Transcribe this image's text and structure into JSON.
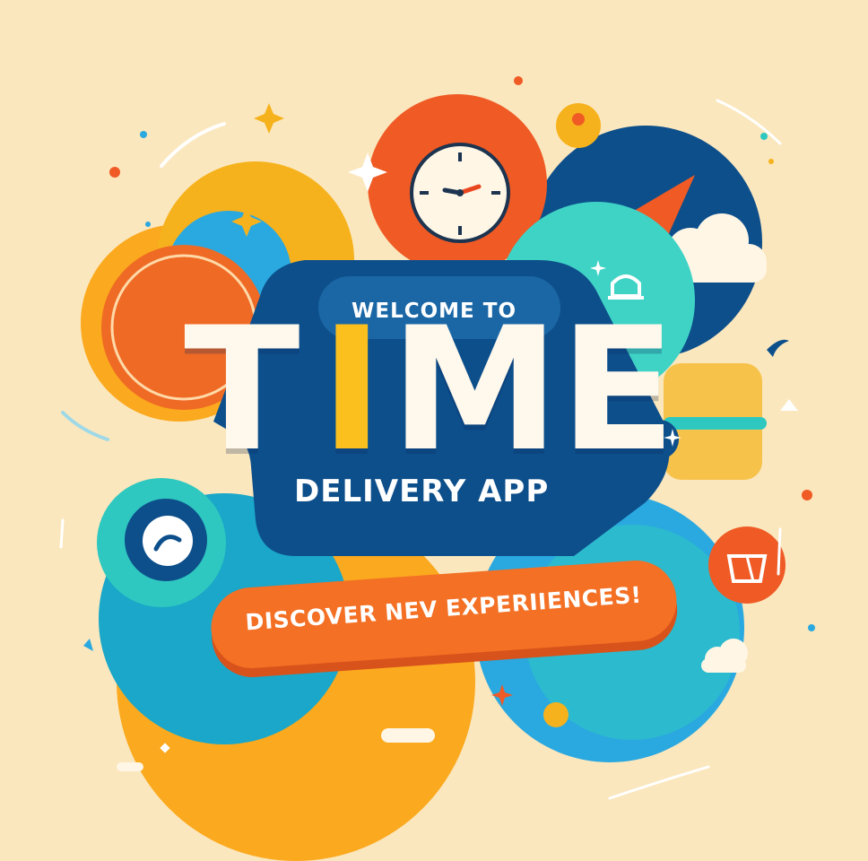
{
  "banner": {
    "welcome_text": "WELCOME TO",
    "title": {
      "part1": "T",
      "part2": "I",
      "part3": "ME"
    },
    "subtitle": "DELIVERY APP",
    "cta_label": "DISCOVER NEV EXPERIIENCES!"
  },
  "icons": [
    "clock-icon",
    "location-pin-icon",
    "bell-icon",
    "chat-bubble-icon",
    "link-icon",
    "shopping-basket-icon",
    "rocket-icon",
    "cloud-icon",
    "sparkle-icon",
    "confetti-icon"
  ],
  "colors": {
    "background": "#fbe7bd",
    "navy": "#0d4f8b",
    "teal": "#2ec8c0",
    "orange": "#f37024",
    "yellow": "#fbbf1e",
    "sky": "#2aa8e0",
    "red_orange": "#ee5a2a",
    "title_white": "#fff8ec"
  }
}
